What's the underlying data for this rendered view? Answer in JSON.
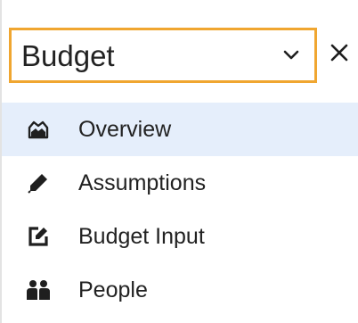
{
  "selector": {
    "label": "Budget",
    "icon": "chevron-down-icon"
  },
  "close": {
    "icon": "close-icon"
  },
  "nav": {
    "active_index": 0,
    "items": [
      {
        "label": "Overview",
        "icon": "overview-icon"
      },
      {
        "label": "Assumptions",
        "icon": "pencil-icon"
      },
      {
        "label": "Budget Input",
        "icon": "edit-icon"
      },
      {
        "label": "People",
        "icon": "people-icon"
      }
    ]
  },
  "colors": {
    "focus_border": "#f0a630",
    "active_background": "#e5eefb",
    "icon": "#1f1f1f"
  }
}
